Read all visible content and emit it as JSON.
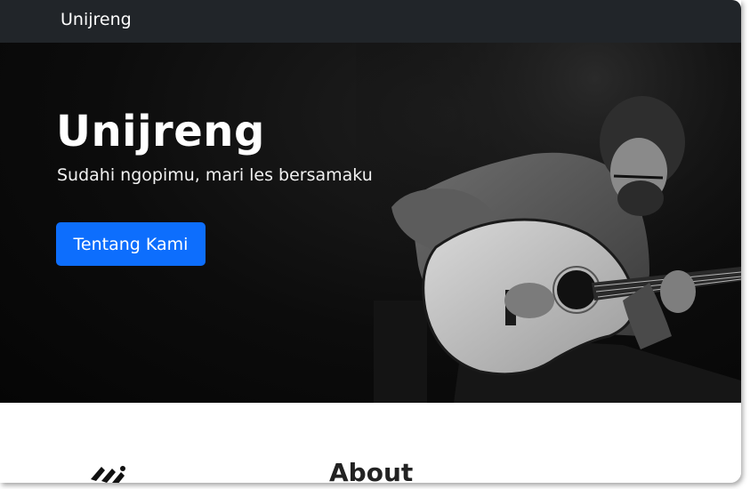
{
  "navbar": {
    "brand": "Unijreng"
  },
  "hero": {
    "title": "Unijreng",
    "subtitle": "Sudahi ngopimu, mari les bersamaku",
    "button_label": "Tentang Kami",
    "image_icon": "guitarist-photo"
  },
  "about": {
    "heading": "About",
    "logo_icon": "guitar-logo-icon"
  },
  "colors": {
    "navbar_bg": "#212529",
    "hero_bg": "#0c0c0c",
    "accent": "#0d6efd",
    "text_light": "#ffffff"
  }
}
